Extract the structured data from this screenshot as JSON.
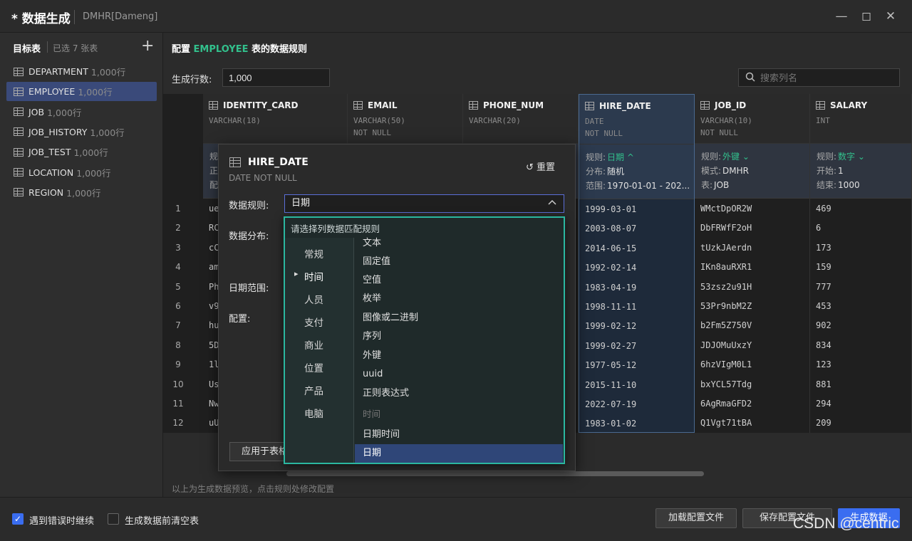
{
  "window": {
    "title": "* 数据生成",
    "connection": "DMHR[Dameng]"
  },
  "sidebar": {
    "header": "目标表",
    "selected_count": "已选 7 张表",
    "tables": [
      {
        "name": "DEPARTMENT",
        "rows": "1,000行",
        "selected": false
      },
      {
        "name": "EMPLOYEE",
        "rows": "1,000行",
        "selected": true
      },
      {
        "name": "JOB",
        "rows": "1,000行",
        "selected": false
      },
      {
        "name": "JOB_HISTORY",
        "rows": "1,000行",
        "selected": false
      },
      {
        "name": "JOB_TEST",
        "rows": "1,000行",
        "selected": false
      },
      {
        "name": "LOCATION",
        "rows": "1,000行",
        "selected": false
      },
      {
        "name": "REGION",
        "rows": "1,000行",
        "selected": false
      }
    ]
  },
  "main": {
    "head_prefix": "配置",
    "head_table": "EMPLOYEE",
    "head_suffix": "表的数据规则",
    "rows_label": "生成行数:",
    "rows_value": "1,000",
    "search_placeholder": "搜索列名",
    "preview_note": "以上为生成数据预览，点击规则处修改配置"
  },
  "columns": [
    {
      "name": "IDENTITY_CARD",
      "type": "VARCHAR(18)",
      "null": "",
      "rule": [
        "规",
        "正",
        "配"
      ]
    },
    {
      "name": "EMAIL",
      "type": "VARCHAR(50)",
      "null": "NOT NULL"
    },
    {
      "name": "PHONE_NUM",
      "type": "VARCHAR(20)",
      "null": ""
    },
    {
      "name": "HIRE_DATE",
      "type": "DATE",
      "null": "NOT NULL",
      "rule": {
        "l1": "规则:",
        "v1": "日期 ^",
        "l2": "分布:",
        "v2": "随机",
        "l3": "范围:",
        "v3": "1970-01-01 - 202..."
      },
      "values": [
        "1999-03-01",
        "2003-08-07",
        "2014-06-15",
        "1992-02-14",
        "1983-04-19",
        "1998-11-11",
        "1999-02-12",
        "1999-02-27",
        "1977-05-12",
        "2015-11-10",
        "2022-07-19",
        "1983-01-02"
      ]
    },
    {
      "name": "JOB_ID",
      "type": "VARCHAR(10)",
      "null": "NOT NULL",
      "rule": {
        "l1": "规则:",
        "v1": "外键 ⌄",
        "l2": "模式:",
        "v2": "DMHR",
        "l3": "表:",
        "v3": "JOB"
      },
      "values": [
        "WMctDpOR2W",
        "DbFRWfF2oH",
        "tUzkJAerdn",
        "IKn8auRXR1",
        "53zsz2u91H",
        "53Pr9nbM2Z",
        "b2Fm5Z750V",
        "JDJOMuUxzY",
        "6hzVIgM0L1",
        "bxYCL57Tdg",
        "6AgRmaGFD2",
        "Q1Vgt71tBA"
      ]
    },
    {
      "name": "SALARY",
      "type": "INT",
      "null": "",
      "rule": {
        "l1": "规则:",
        "v1": "数字 ⌄",
        "l2": "开始:",
        "v2": "1",
        "l3": "结束:",
        "v3": "1000"
      },
      "values": [
        "469",
        "6",
        "173",
        "159",
        "777",
        "453",
        "902",
        "834",
        "123",
        "881",
        "294",
        "209"
      ]
    }
  ],
  "identity_values": [
    "ue",
    "RC",
    "cC",
    "am",
    "Ph",
    "v9",
    "hu",
    "5D",
    "1l",
    "Us",
    "Nw",
    "uU"
  ],
  "row_numbers": [
    "1",
    "2",
    "3",
    "4",
    "5",
    "6",
    "7",
    "8",
    "9",
    "10",
    "11",
    "12"
  ],
  "dialog": {
    "title": "HIRE_DATE",
    "subtitle": "DATE NOT NULL",
    "reset": "重置",
    "rule_label": "数据规则:",
    "rule_value": "日期",
    "dist_label": "数据分布:",
    "range_label": "日期范围:",
    "config_label": "配置:",
    "apply_button": "应用于表格",
    "dropdown": {
      "header": "请选择列数据匹配规则",
      "categories": [
        "常规",
        "时间",
        "人员",
        "支付",
        "商业",
        "位置",
        "产品",
        "电脑"
      ],
      "active_category": "时间",
      "options": [
        "文本",
        "固定值",
        "空值",
        "枚举",
        "图像或二进制",
        "序列",
        "外键",
        "uuid",
        "正则表达式"
      ],
      "group_label": "时间",
      "group_options": [
        "日期时间",
        "日期"
      ],
      "selected": "日期"
    }
  },
  "footer": {
    "continue_on_error": "遇到错误时继续",
    "clear_before": "生成数据前清空表",
    "load_config": "加载配置文件",
    "save_config": "保存配置文件",
    "generate": "生成数据",
    "watermark": "CSDN @centric"
  },
  "colors": {
    "accent": "#32c08c",
    "primary": "#3a6df0",
    "dropdown_border": "#2bb7a0"
  }
}
